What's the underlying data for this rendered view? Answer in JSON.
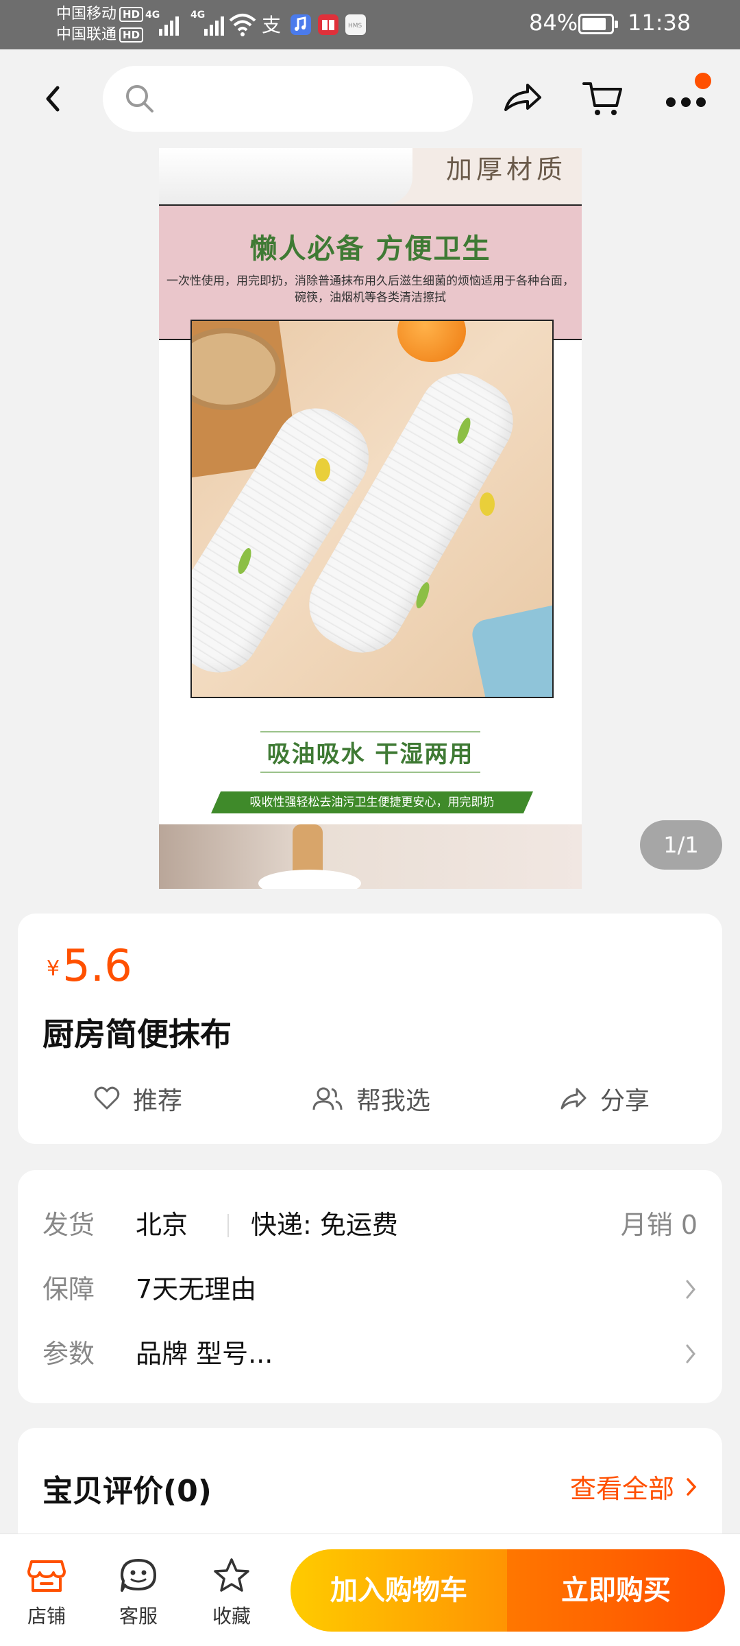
{
  "status_bar": {
    "carrier_1": "中国移动",
    "carrier_2": "中国联通",
    "hd_label": "HD",
    "network_1": "4G",
    "network_2": "4G",
    "battery_percent": "84%",
    "battery_level": 0.84,
    "time": "11:38",
    "app_icons": [
      "alipay-icon",
      "music-icon",
      "reader-icon",
      "hms-icon"
    ]
  },
  "nav": {
    "search_placeholder": "",
    "has_notification_badge": true,
    "badge_color": "#ff5000"
  },
  "product_image": {
    "top_caption": "加厚材质",
    "headline": "懒人必备 方便卫生",
    "description": "一次性使用，用完即扔，消除普通抹布用久后滋生细菌的烦恼适用于各种台面，碗筷，油烟机等各类清洁擦拭",
    "feature_title": "吸油吸水 干湿两用",
    "feature_banner": "吸收性强轻松去油污卫生便捷更安心，用完即扔",
    "indicator": "1/1"
  },
  "product": {
    "currency": "¥",
    "price": "5.6",
    "title": "厨房简便抹布",
    "accent_color": "#ff5000",
    "actions": [
      {
        "label": "推荐",
        "icon": "heart-icon"
      },
      {
        "label": "帮我选",
        "icon": "people-icon"
      },
      {
        "label": "分享",
        "icon": "share-icon"
      }
    ]
  },
  "shipping": {
    "ship_key": "发货",
    "ship_from": "北京",
    "express": "快递:  免运费",
    "monthly_sales": "月销  0",
    "guarantee_key": "保障",
    "guarantee_value": "7天无理由",
    "params_key": "参数",
    "params_value": "品牌 型号..."
  },
  "reviews": {
    "title": "宝贝评价(0)",
    "view_all": "查看全部"
  },
  "bottom_bar": {
    "store": "店铺",
    "service": "客服",
    "favorite": "收藏",
    "add_to_cart": "加入购物车",
    "buy_now": "立即购买"
  }
}
